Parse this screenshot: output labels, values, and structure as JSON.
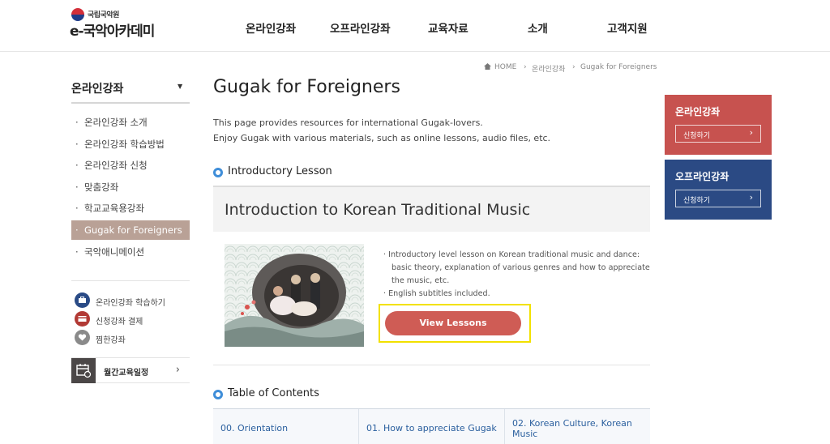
{
  "header": {
    "logo_small": "국립국악원",
    "logo_main": "e-국악아카데미",
    "nav": [
      "온라인강좌",
      "오프라인강좌",
      "교육자료",
      "소개",
      "고객지원"
    ]
  },
  "sidebar": {
    "title": "온라인강좌",
    "items": [
      {
        "label": "온라인강좌 소개"
      },
      {
        "label": "온라인강좌 학습방법"
      },
      {
        "label": "온라인강좌 신청"
      },
      {
        "label": "맞춤강좌"
      },
      {
        "label": "학교교육용강좌"
      },
      {
        "label": "Gugak for Foreigners"
      },
      {
        "label": "국악애니메이션"
      }
    ],
    "quick": [
      {
        "label": "온라인강좌 학습하기",
        "color": "#2a4b86"
      },
      {
        "label": "신청강좌 결제",
        "color": "#b23a35"
      },
      {
        "label": "찜한강좌",
        "color": "#8a8a8a"
      }
    ],
    "monthly": "월간교육일정"
  },
  "breadcrumb": {
    "home": "HOME",
    "level1": "온라인강좌",
    "level2": "Gugak for Foreigners"
  },
  "main": {
    "title": "Gugak for Foreigners",
    "intro_line1": "This page provides resources for international Gugak-lovers.",
    "intro_line2": "Enjoy Gugak with various materials, such as online lessons, audio files, etc.",
    "section_intro": "Introductory Lesson",
    "lesson_title": "Introduction to Korean Traditional Music",
    "bullet1_l1": "Introductory level lesson on Korean traditional music and dance:",
    "bullet1_l2": "basic theory, explanation of various genres and how to appreciate",
    "bullet1_l3": "the music, etc.",
    "bullet2": "English subtitles included.",
    "view_button": "View Lessons",
    "section_toc": "Table of Contents",
    "toc": [
      "00. Orientation",
      "01. How to appreciate Gugak",
      "02. Korean Culture, Korean",
      "Music"
    ]
  },
  "right": {
    "online_title": "온라인강좌",
    "online_btn": "신청하기",
    "online_color": "#c7524f",
    "offline_title": "오프라인강좌",
    "offline_btn": "신청하기",
    "offline_color": "#2b4a84"
  }
}
